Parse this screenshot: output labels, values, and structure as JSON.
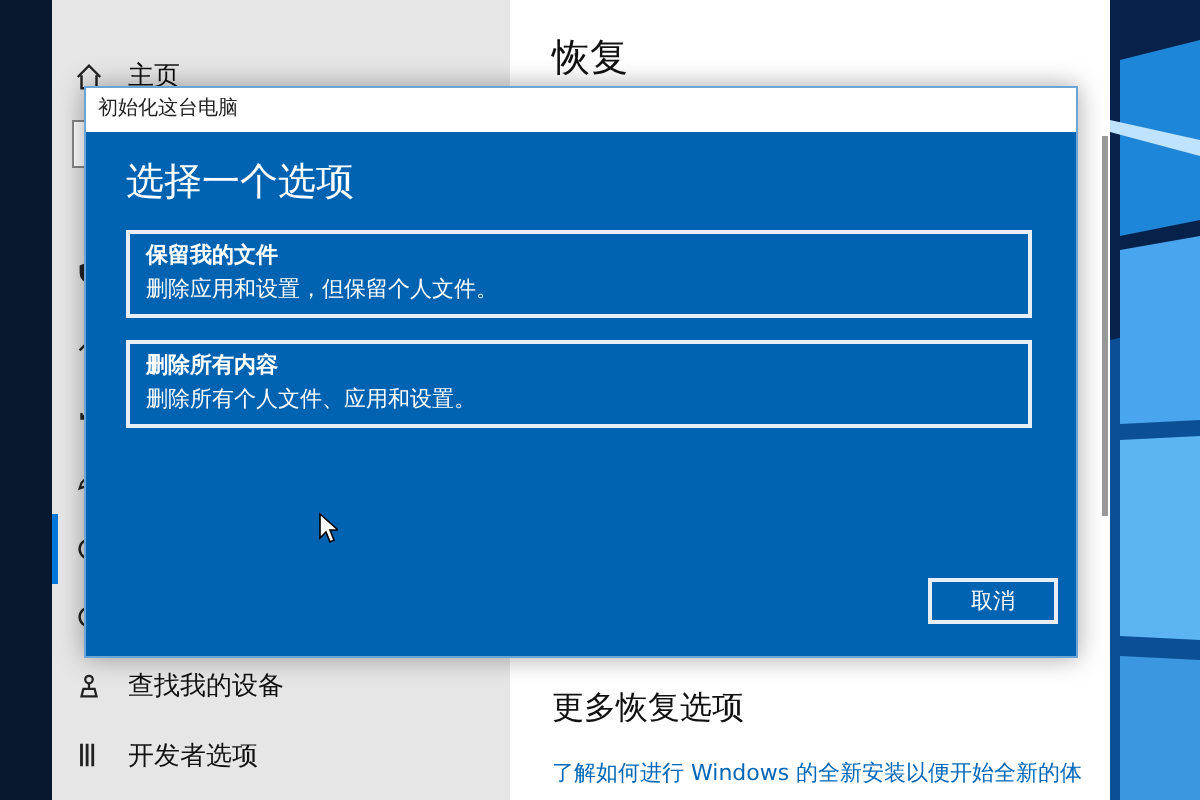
{
  "settings_window": {
    "sidebar": {
      "home": {
        "label": "主页"
      },
      "items": [
        {
          "selected": false
        },
        {
          "selected": false
        },
        {
          "selected": false
        },
        {
          "selected": false
        },
        {
          "selected": true
        },
        {
          "selected": false
        },
        {
          "label": "查找我的设备",
          "selected": false
        },
        {
          "label": "开发者选项",
          "selected": false
        }
      ]
    },
    "content": {
      "heading": "恢复",
      "section_title": "更多恢复选项",
      "link": "了解如何进行 Windows 的全新安装以便开始全新的体"
    }
  },
  "dialog": {
    "title": "初始化这台电脑",
    "heading": "选择一个选项",
    "options": [
      {
        "title": "保留我的文件",
        "description": "删除应用和设置，但保留个人文件。"
      },
      {
        "title": "删除所有内容",
        "description": "删除所有个人文件、应用和设置。"
      }
    ],
    "cancel_button": "取消"
  }
}
